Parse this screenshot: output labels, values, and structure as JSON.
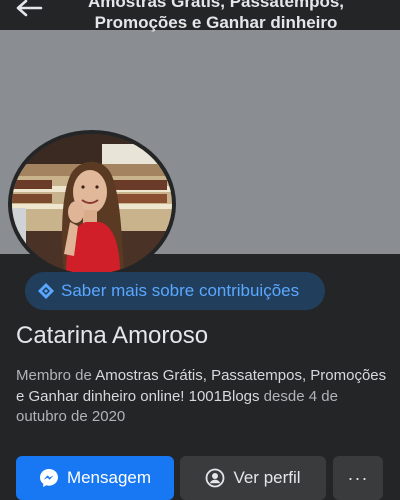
{
  "header": {
    "title_line1": "Amostras Grátis, Passatempos,",
    "title_line2": "Promoções e Ganhar dinheiro",
    "back_icon": "arrow-left-icon"
  },
  "colors": {
    "background": "#242526",
    "cover": "#8a8d91",
    "accent": "#1877f2",
    "pill_background": "#213f5d",
    "pill_text": "#5aa7ff",
    "secondary_button": "#3a3b3c"
  },
  "contributions": {
    "label": "Saber mais sobre contribuições",
    "icon": "badge-icon"
  },
  "profile": {
    "name": "Catarina Amoroso",
    "desc_prefix": "Membro de ",
    "desc_group": "Amostras Grátis, Passatempos, Promoções e Ganhar dinheiro online! 1001Blogs",
    "desc_suffix": " desde 4 de outubro de 2020"
  },
  "actions": {
    "message_label": "Mensagem",
    "message_icon": "messenger-icon",
    "view_profile_label": "Ver perfil",
    "view_profile_icon": "user-circle-icon",
    "more_label": "···",
    "more_icon": "more-icon"
  }
}
